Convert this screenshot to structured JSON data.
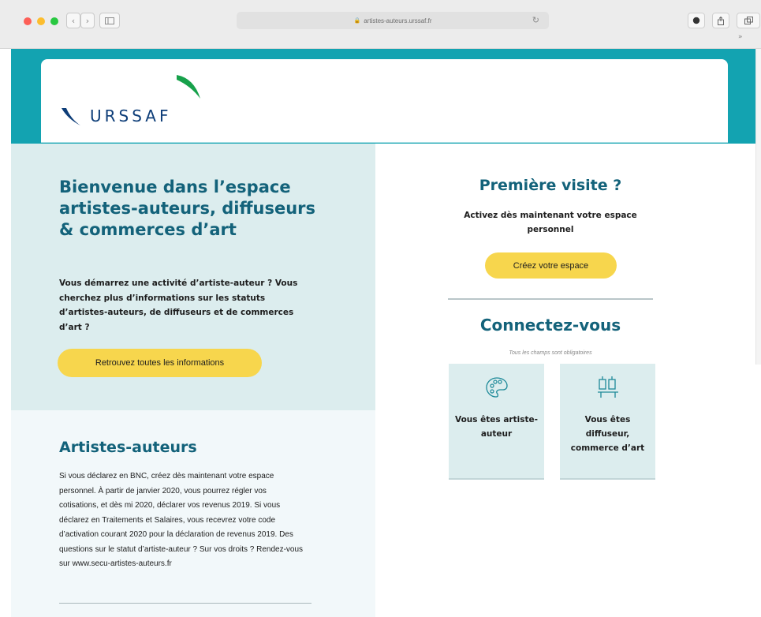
{
  "browser": {
    "url": "artistes-auteurs.urssaf.fr",
    "back_glyph": "‹",
    "forward_glyph": "›",
    "reload_glyph": "↻",
    "more_glyph": "»"
  },
  "header": {
    "logo_text": "URSSAF",
    "logo_colors": {
      "swoosh_blue": "#0d3d78",
      "swoosh_green": "#17a14b"
    },
    "accent_color": "#13a3b1"
  },
  "welcome": {
    "title": "Bienvenue dans l’espace artistes-auteurs, diffuseurs & commerces d’art",
    "description": "Vous démarrez une activité d’artiste-auteur ? Vous cherchez plus d’informations sur les statuts d’artistes-auteurs, de diffuseurs et de commerces d’art ?",
    "button_label": "Retrouvez toutes les informations"
  },
  "artistes": {
    "title": "Artistes-auteurs",
    "text": "Si vous déclarez en BNC, créez dès maintenant votre espace personnel. À partir de janvier 2020, vous pourrez régler vos cotisations, et dès mi 2020, déclarer vos revenus 2019. Si vous déclarez en Traitements et Salaires, vous recevrez votre code d’activation courant 2020 pour la déclaration de revenus 2019. Des questions sur le statut d’artiste-auteur ? Sur vos droits ? Rendez-vous sur www.secu-artistes-auteurs.fr"
  },
  "first_visit": {
    "title": "Première visite ?",
    "description": "Activez dès maintenant votre espace personnel",
    "button_label": "Créez votre espace"
  },
  "connect": {
    "title": "Connectez-vous",
    "required_note": "Tous les champs sont obligatoires",
    "cards": [
      {
        "label": "Vous êtes artiste-auteur",
        "icon": "palette-icon"
      },
      {
        "label": "Vous êtes diffuseur, commerce d’art",
        "icon": "shop-icon"
      }
    ]
  },
  "colors": {
    "primary_text": "#13627a",
    "button_yellow": "#f7d64d",
    "panel_light": "#dcedee"
  }
}
